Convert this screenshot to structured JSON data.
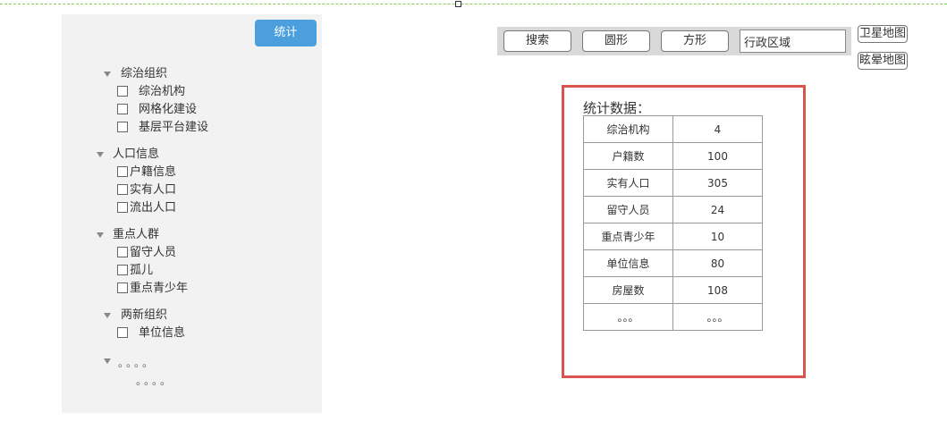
{
  "toolbar": {
    "search_label": "搜索",
    "circle_label": "圆形",
    "square_label": "方形",
    "region_value": "行政区域"
  },
  "map_buttons": {
    "satellite_label": "卫星地图",
    "halo_label": "眩晕地图"
  },
  "left_panel": {
    "stat_button_label": "统计",
    "groups": [
      {
        "title": "综治组织",
        "items": [
          "综治机构",
          "网格化建设",
          "基层平台建设"
        ]
      },
      {
        "title": "人口信息",
        "items": [
          "户籍信息",
          "实有人口",
          "流出人口"
        ]
      },
      {
        "title": "重点人群",
        "items": [
          "留守人员",
          "孤儿",
          "重点青少年"
        ]
      },
      {
        "title": "两新组织",
        "items": [
          "单位信息"
        ]
      },
      {
        "title": "。。。。",
        "items": [
          "。。。。"
        ]
      }
    ]
  },
  "stats": {
    "title": "统计数据：",
    "rows": [
      [
        "综治机构",
        "4"
      ],
      [
        "户籍数",
        "100"
      ],
      [
        "实有人口",
        "305"
      ],
      [
        "留守人员",
        "24"
      ],
      [
        "重点青少年",
        "10"
      ],
      [
        "单位信息",
        "80"
      ],
      [
        "房屋数",
        "108"
      ],
      [
        "。。。",
        "。。。"
      ]
    ]
  }
}
